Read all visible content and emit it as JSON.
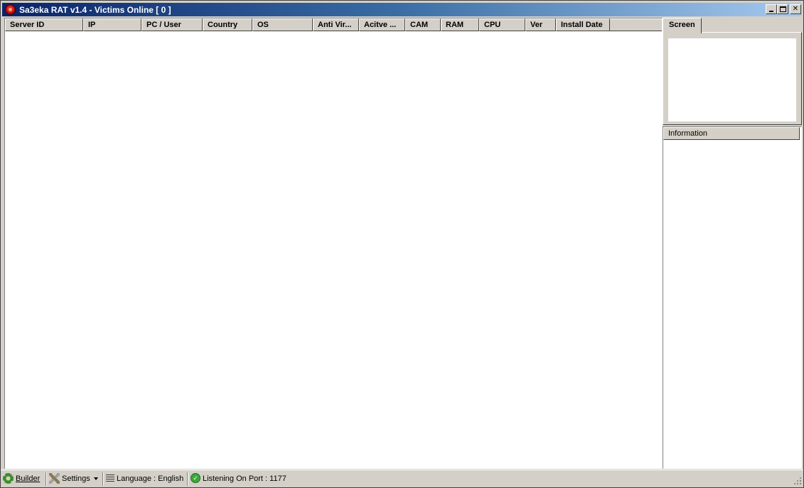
{
  "window": {
    "title": "Sa3eka RAT v1.4 - Victims Online [ 0 ]",
    "icon": "app-icon"
  },
  "title_buttons": {
    "minimize": "minimize-icon",
    "maximize": "maximize-icon",
    "close": "✕"
  },
  "victims_list": {
    "columns": [
      "Server ID",
      "IP",
      "PC / User",
      "Country",
      "OS",
      "Anti Vir...",
      "Acitve ...",
      "CAM",
      "RAM",
      "CPU",
      "Ver",
      "Install Date"
    ],
    "rows": []
  },
  "side_panel": {
    "tab_label": "Screen",
    "information_header": "Information"
  },
  "statusbar": {
    "builder_label": "Builder",
    "settings_label": "Settings",
    "language_label": "Language : English",
    "port_label": "Listening On Port : 1177",
    "port_status_glyph": "✓"
  },
  "colors": {
    "titlebar_start": "#0a246a",
    "titlebar_end": "#a6caf0",
    "face": "#d4d0c8"
  }
}
